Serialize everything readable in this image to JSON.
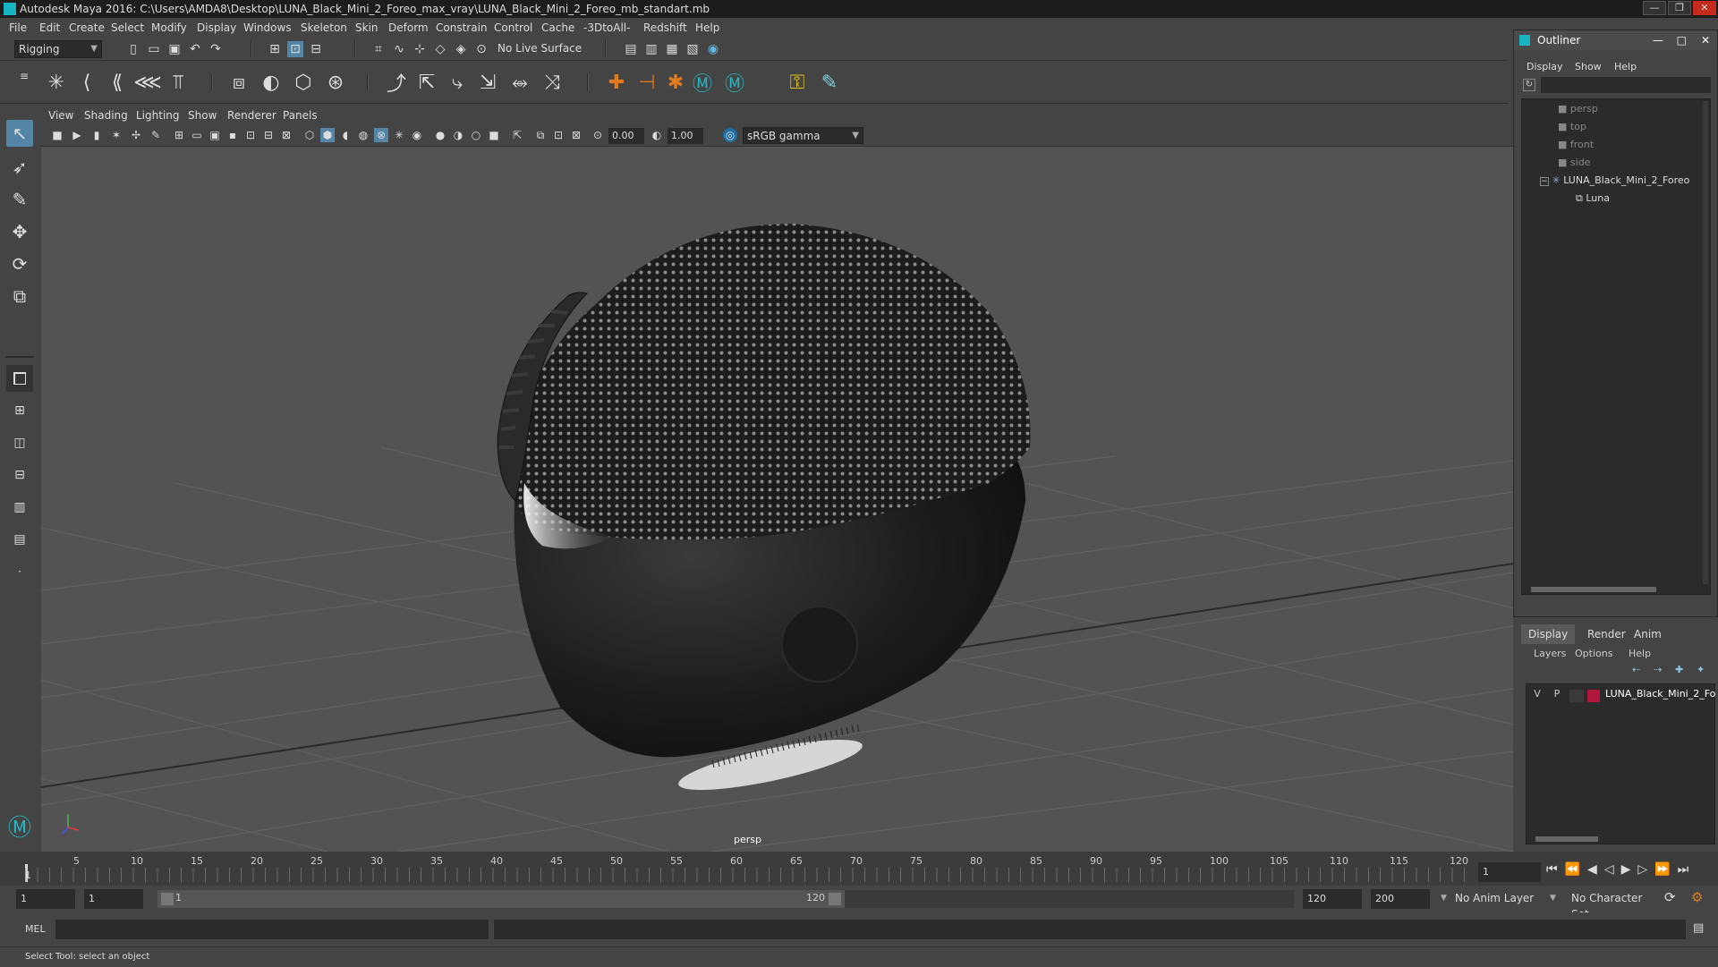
{
  "window": {
    "title": "Autodesk Maya 2016: C:\\Users\\AMDA8\\Desktop\\LUNA_Black_Mini_2_Foreo_max_vray\\LUNA_Black_Mini_2_Foreo_mb_standart.mb",
    "minimize": "—",
    "maximize": "❐",
    "close": "✕"
  },
  "menubar": [
    "File",
    "Edit",
    "Create",
    "Select",
    "Modify",
    "Display",
    "Windows",
    "Skeleton",
    "Skin",
    "Deform",
    "Constrain",
    "Control",
    "Cache",
    "-3DtoAll-",
    "Redshift",
    "Help"
  ],
  "statusline": {
    "menuset": "Rigging",
    "live_surface": "No Live Surface"
  },
  "viewport": {
    "menus": [
      "View",
      "Shading",
      "Lighting",
      "Show",
      "Renderer",
      "Panels"
    ],
    "near_value": "0.00",
    "far_value": "1.00",
    "color_space": "sRGB gamma",
    "camera_label": "persp",
    "accent": "#1f6fa3"
  },
  "outliner": {
    "title": "Outliner",
    "menus": [
      "Display",
      "Show",
      "Help"
    ],
    "items": [
      {
        "label": "persp",
        "dim": true
      },
      {
        "label": "top",
        "dim": true
      },
      {
        "label": "front",
        "dim": true
      },
      {
        "label": "side",
        "dim": true
      },
      {
        "label": "LUNA_Black_Mini_2_Foreo",
        "dim": false
      },
      {
        "label": "Luna",
        "dim": false
      }
    ]
  },
  "layers": {
    "tabs": [
      "Display",
      "Render",
      "Anim"
    ],
    "menus": [
      "Layers",
      "Options",
      "Help"
    ],
    "row": {
      "v": "V",
      "p": "P",
      "name": "LUNA_Black_Mini_2_Fo",
      "color": "#b0153c"
    }
  },
  "timeline": {
    "ticks": [
      "1",
      "5",
      "10",
      "15",
      "20",
      "25",
      "30",
      "35",
      "40",
      "45",
      "50",
      "55",
      "60",
      "65",
      "70",
      "75",
      "80",
      "85",
      "90",
      "95",
      "100",
      "105",
      "110",
      "115",
      "120"
    ],
    "current_frame": "1"
  },
  "range": {
    "start": "1",
    "playback_start": "1",
    "slider_start": "1",
    "slider_end": "120",
    "playback_end": "120",
    "end": "200",
    "anim_layer": "No Anim Layer",
    "character_set": "No Character Set"
  },
  "cmdline": {
    "label": "MEL"
  },
  "helpline": {
    "text": "Select Tool: select an object"
  }
}
